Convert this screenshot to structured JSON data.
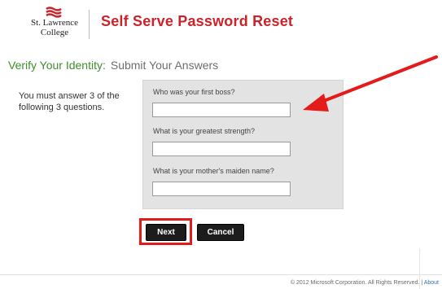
{
  "header": {
    "logo_text_line1": "St. Lawrence",
    "logo_text_line2": "College",
    "title": "Self Serve Password Reset"
  },
  "step": {
    "title": "Verify Your Identity:",
    "subtitle": "Submit Your Answers"
  },
  "instructions": "You must answer 3 of the following 3 questions.",
  "questions": [
    {
      "label": "Who was your first boss?",
      "value": ""
    },
    {
      "label": "What is your greatest strength?",
      "value": ""
    },
    {
      "label": "What is your mother's maiden name?",
      "value": ""
    }
  ],
  "buttons": {
    "next_label": "Next",
    "cancel_label": "Cancel"
  },
  "footer": {
    "copyright": "© 2012 Microsoft Corporation. All Rights Reserved.",
    "separator": "|",
    "about_link": "About"
  },
  "colors": {
    "brand_red": "#cc2229",
    "step_green": "#3f8f2e",
    "annotation_red": "#e41b1b",
    "button_dark": "#1c1c1c"
  }
}
